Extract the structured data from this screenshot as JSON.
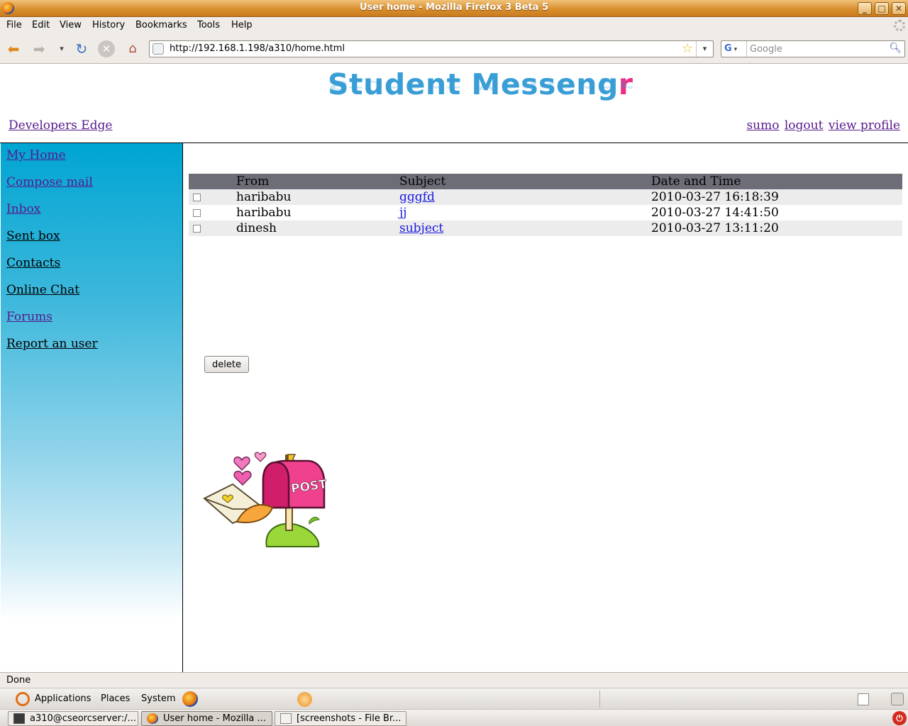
{
  "window": {
    "title": "User home - Mozilla Firefox 3 Beta 5",
    "controls": [
      "_",
      "□",
      "✕"
    ]
  },
  "menubar": [
    "File",
    "Edit",
    "View",
    "History",
    "Bookmarks",
    "Tools",
    "Help"
  ],
  "navbar": {
    "url": "http://192.168.1.198/a310/home.html",
    "search_engine": "G",
    "search_placeholder": "Google"
  },
  "header": {
    "logo_text": "Student Messeng",
    "logo_text_accent": "r",
    "left_link": "Developers Edge",
    "user_links": [
      "sumo",
      "logout",
      "view profile"
    ]
  },
  "sidebar": {
    "items": [
      {
        "label": "My Home",
        "visited": true
      },
      {
        "label": "Compose mail",
        "visited": true
      },
      {
        "label": "Inbox",
        "visited": true
      },
      {
        "label": "Sent box",
        "visited": false
      },
      {
        "label": "Contacts",
        "visited": false
      },
      {
        "label": "Online Chat",
        "visited": false
      },
      {
        "label": "Forums",
        "visited": true
      },
      {
        "label": "Report an user",
        "visited": false
      }
    ]
  },
  "inbox": {
    "columns": [
      "",
      "From",
      "Subject",
      "Date and Time"
    ],
    "rows": [
      {
        "from": "haribabu",
        "subject": "gggfd",
        "datetime": "2010-03-27 16:18:39",
        "checked": false
      },
      {
        "from": "haribabu",
        "subject": "jj",
        "datetime": "2010-03-27 14:41:50",
        "checked": false
      },
      {
        "from": "dinesh",
        "subject": "subject",
        "datetime": "2010-03-27 13:11:20",
        "checked": false
      }
    ],
    "delete_label": "delete"
  },
  "statusbar": {
    "text": "Done"
  },
  "gnome": {
    "top_menus": [
      "Applications",
      "Places",
      "System"
    ],
    "tasks": [
      {
        "label": "a310@cseorcserver:/...",
        "icon": "terminal-icon"
      },
      {
        "label": "User home - Mozilla ...",
        "icon": "firefox-icon",
        "active": true
      },
      {
        "label": "[screenshots - File Br...",
        "icon": "file-browser-icon"
      }
    ]
  },
  "colors": {
    "sidebar_top": "#00a5d2",
    "table_header": "#6d6d78",
    "logo_blue": "#3a9ed6",
    "logo_pink": "#ee2f85",
    "titlebar": "#d98f2e"
  }
}
